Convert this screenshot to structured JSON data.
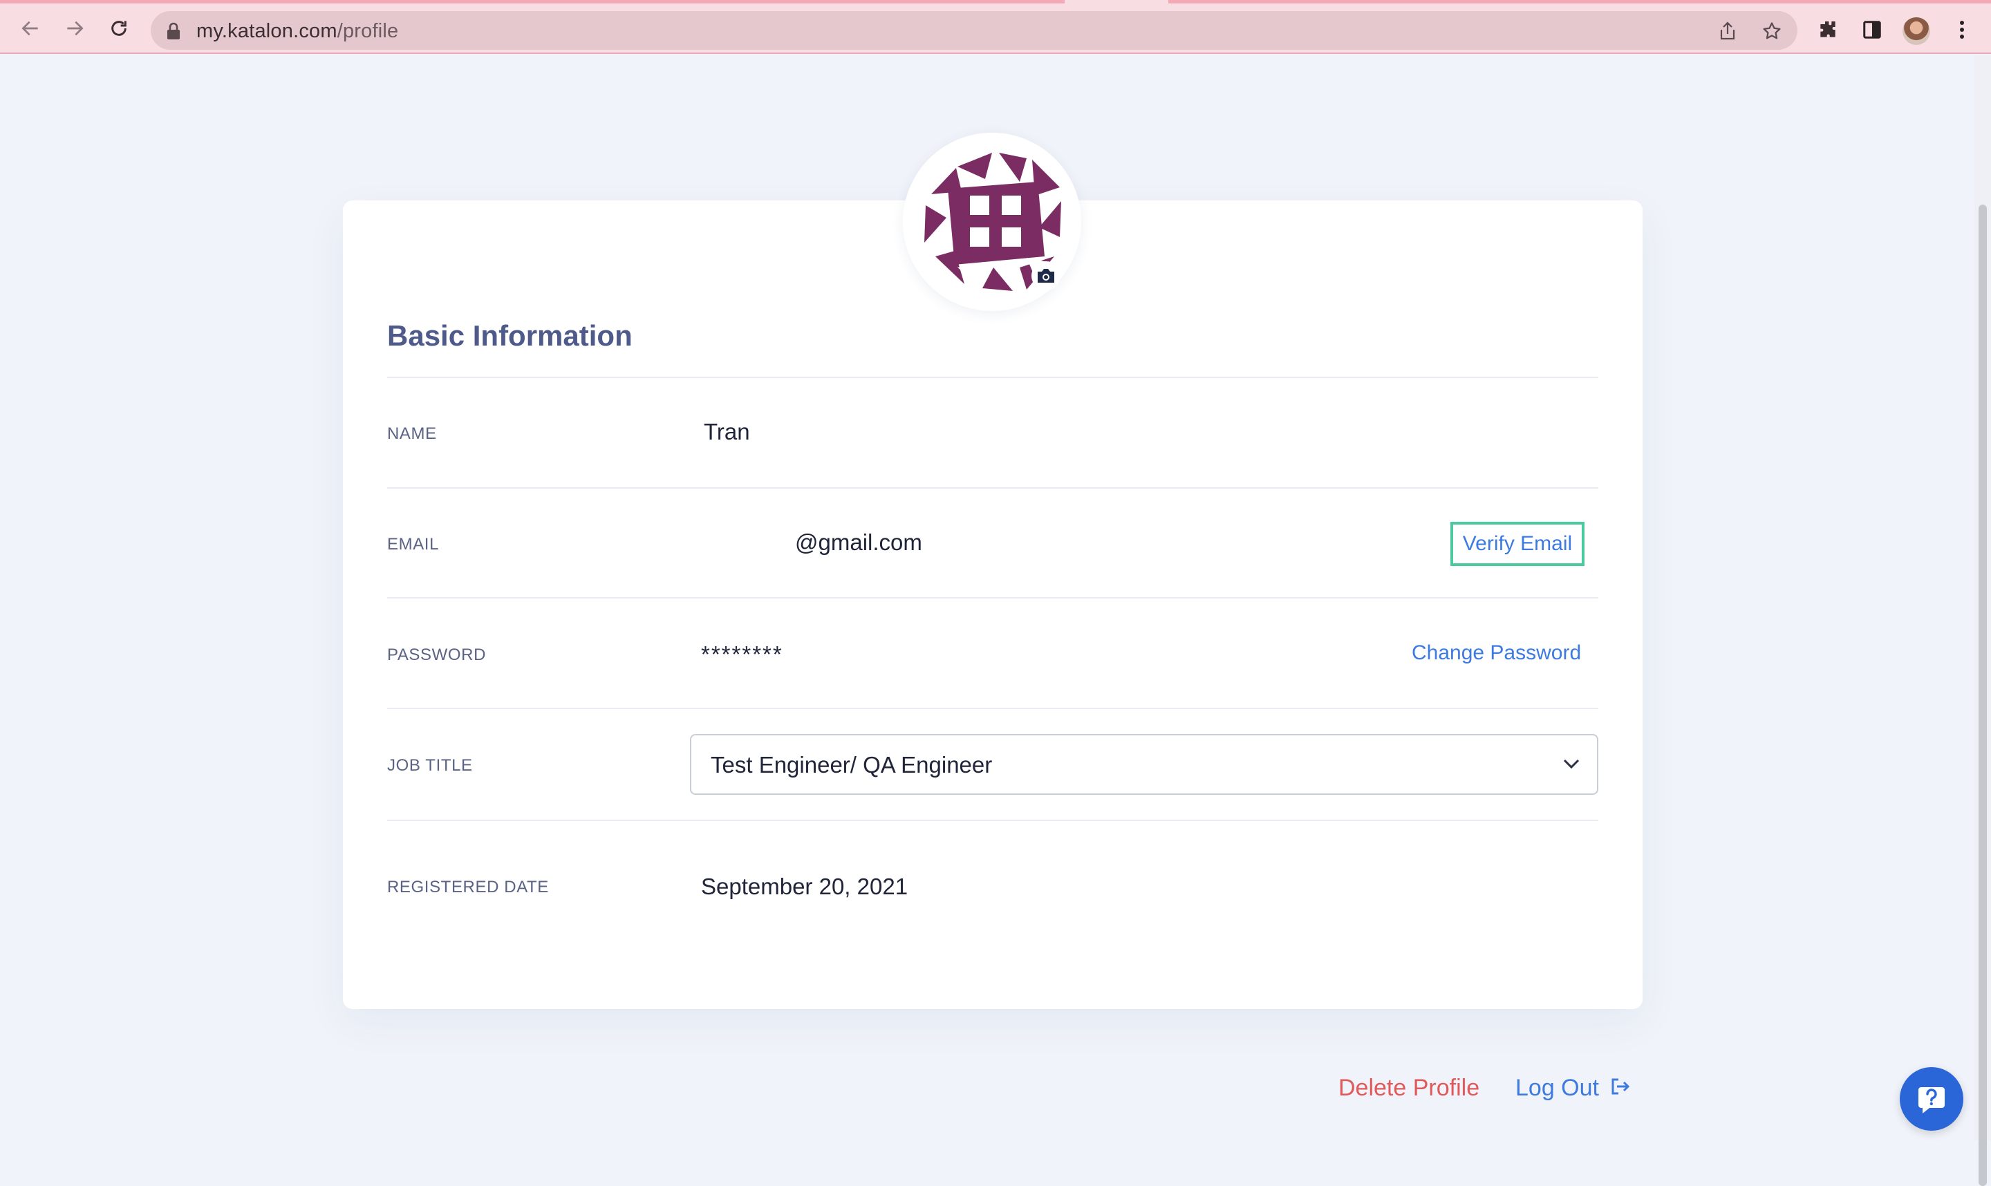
{
  "browser": {
    "url_host": "my.katalon.com",
    "url_path": "/profile",
    "icons": [
      "back-arrow-icon",
      "forward-arrow-icon",
      "reload-icon",
      "lock-icon",
      "share-icon",
      "star-icon",
      "extensions-puzzle-icon",
      "side-panel-icon",
      "profile-avatar",
      "kebab-menu-icon"
    ]
  },
  "profile": {
    "section_title": "Basic Information",
    "avatar_icon": "camera-icon",
    "fields": {
      "name": {
        "label": "NAME",
        "value": "Tran"
      },
      "email": {
        "label": "EMAIL",
        "value": "@gmail.com",
        "action": "Verify Email"
      },
      "password": {
        "label": "PASSWORD",
        "value": "********",
        "action": "Change Password"
      },
      "job_title": {
        "label": "JOB TITLE",
        "value": "Test Engineer/ QA Engineer"
      },
      "registered_date": {
        "label": "REGISTERED DATE",
        "value": "September 20, 2021"
      }
    }
  },
  "footer": {
    "delete_label": "Delete Profile",
    "logout_label": "Log Out"
  },
  "colors": {
    "accent": "#3e7be0",
    "danger": "#e05a5a",
    "highlight": "#4cc9a0",
    "avatar": "#7b2d63"
  }
}
